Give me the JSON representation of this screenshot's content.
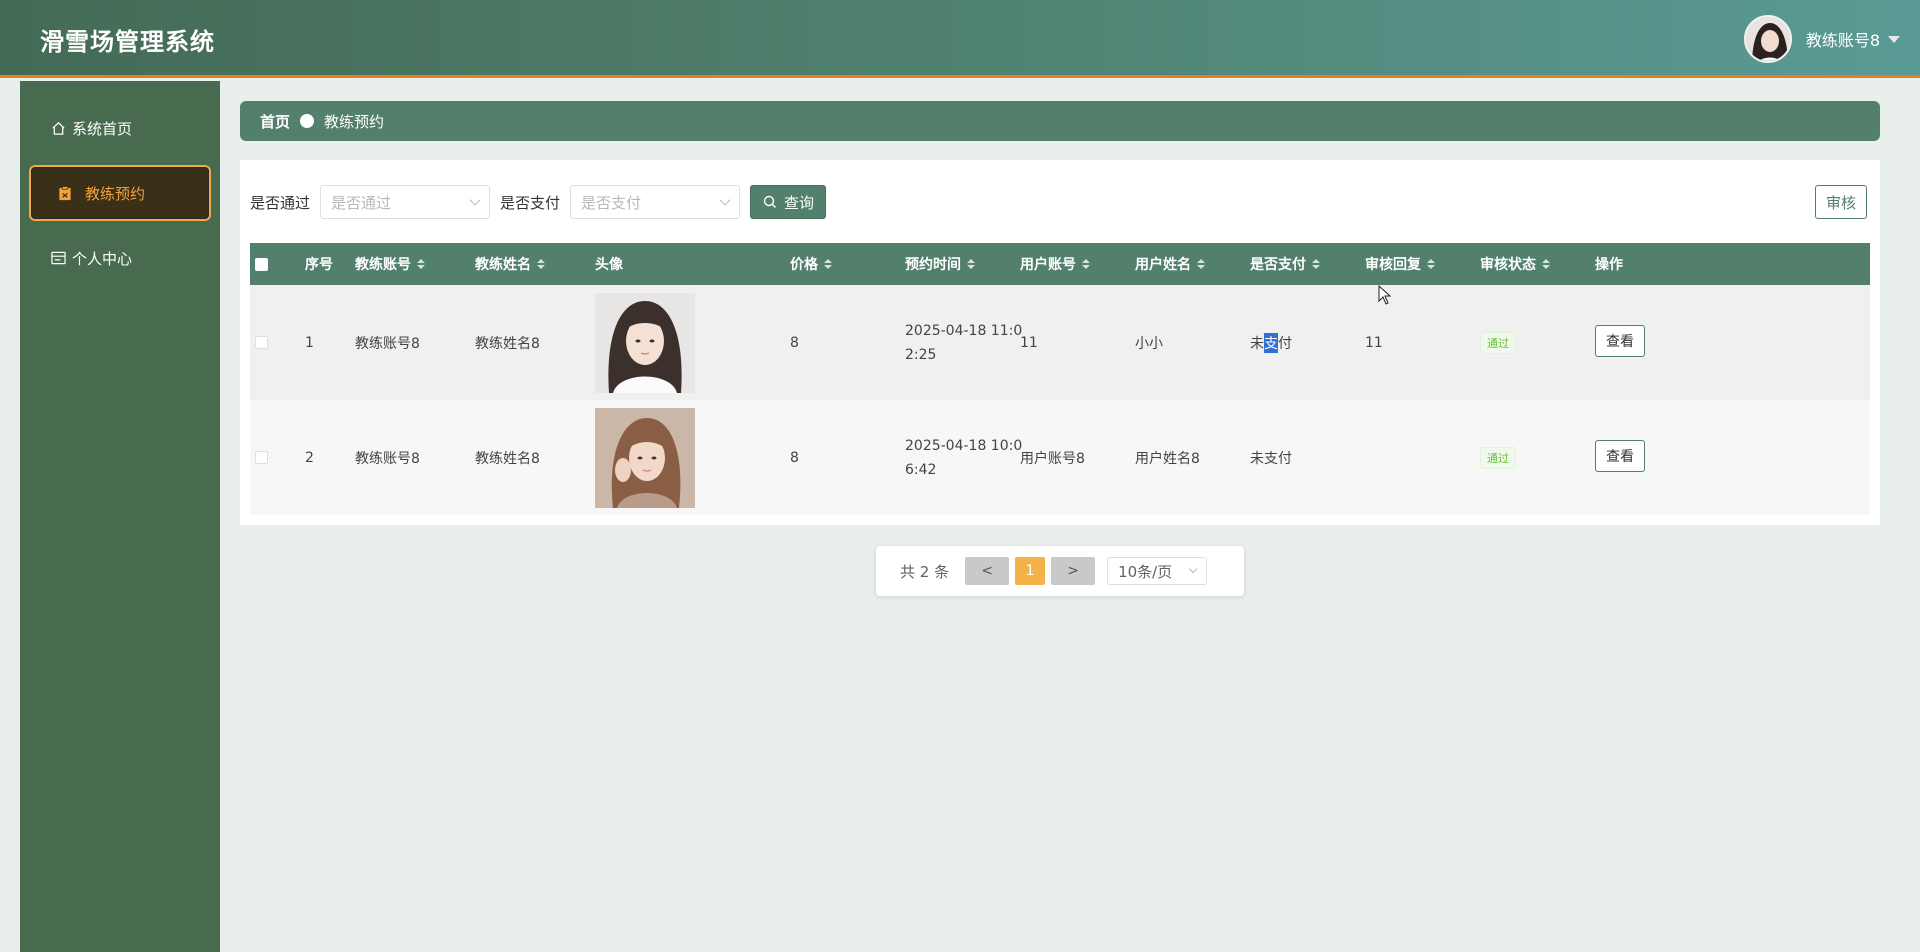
{
  "app": {
    "title": "滑雪场管理系统"
  },
  "user": {
    "name": "教练账号8"
  },
  "sidebar": {
    "items": [
      {
        "label": "系统首页",
        "icon": "home-icon"
      },
      {
        "label": "教练预约",
        "icon": "clipboard-icon"
      },
      {
        "label": "个人中心",
        "icon": "id-card-icon"
      }
    ]
  },
  "breadcrumb": {
    "home": "首页",
    "current": "教练预约"
  },
  "filters": {
    "passed_label": "是否通过",
    "passed_placeholder": "是否通过",
    "paid_label": "是否支付",
    "paid_placeholder": "是否支付",
    "query_label": "查询",
    "audit_label": "审核"
  },
  "table": {
    "headers": [
      "序号",
      "教练账号",
      "教练姓名",
      "头像",
      "价格",
      "预约时间",
      "用户账号",
      "用户姓名",
      "是否支付",
      "审核回复",
      "审核状态",
      "操作"
    ],
    "rows": [
      {
        "index": "1",
        "coach_account": "教练账号8",
        "coach_name": "教练姓名8",
        "price": "8",
        "time_line1": "2025-04-18 11:0",
        "time_line2": "2:25",
        "user_account": "11",
        "user_name": "小小",
        "paid_a": "未",
        "paid_b": "支",
        "paid_c": "付",
        "reply": "11",
        "status": "通过",
        "action": "查看"
      },
      {
        "index": "2",
        "coach_account": "教练账号8",
        "coach_name": "教练姓名8",
        "price": "8",
        "time_line1": "2025-04-18 10:0",
        "time_line2": "6:42",
        "user_account": "用户账号8",
        "user_name": "用户姓名8",
        "paid": "未支付",
        "reply": "",
        "status": "通过",
        "action": "查看"
      }
    ]
  },
  "pagination": {
    "total": "共 2 条",
    "prev": "<",
    "current": "1",
    "next": ">",
    "page_size": "10条/页"
  },
  "colors": {
    "primary": "#537f6d",
    "accent": "#f3a23a",
    "sidebar": "#486a4f"
  }
}
